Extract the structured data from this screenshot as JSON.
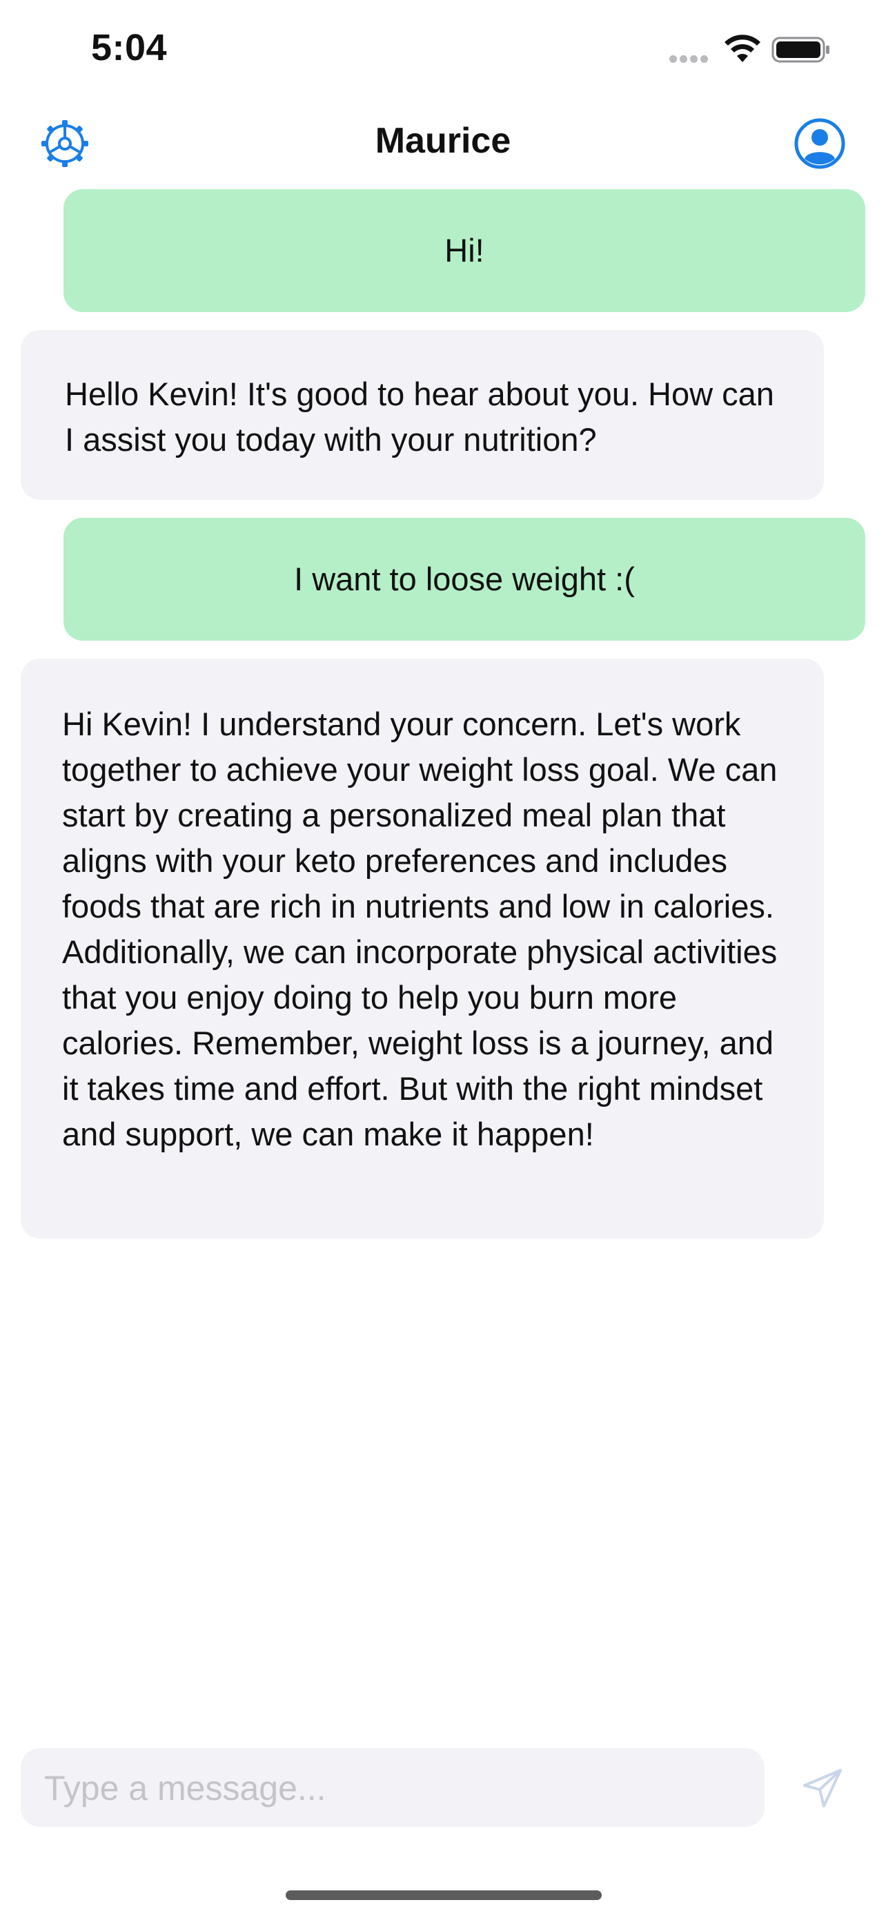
{
  "status_bar": {
    "time": "5:04"
  },
  "header": {
    "title": "Maurice",
    "left_icon": "settings-gear-icon",
    "right_icon": "profile-icon"
  },
  "messages": [
    {
      "role": "user",
      "text": "Hi!"
    },
    {
      "role": "assistant",
      "text": "Hello Kevin! It's good to hear about you. How can I assist you today with your nutrition?"
    },
    {
      "role": "user",
      "text": "I want to loose weight :("
    },
    {
      "role": "assistant",
      "text": "Hi Kevin! I understand your concern. Let's work together to achieve your weight loss goal. We can start by creating a personalized meal plan that aligns with your keto preferences and includes foods that are rich in nutrients and low in calories. Additionally, we can incorporate physical activities that you enjoy doing to help you burn more calories. Remember, weight loss is a journey, and it takes time and effort. But with the right mindset and support, we can make it happen!"
    }
  ],
  "composer": {
    "placeholder": "Type a message...",
    "value": "",
    "send_icon": "send-icon"
  },
  "colors": {
    "accent": "#1a7ee6",
    "user_bubble": "#b4efc8",
    "assistant_bubble": "#f2f2f7",
    "input_background": "#f2f2f7",
    "send_disabled": "#c9d6ea"
  }
}
